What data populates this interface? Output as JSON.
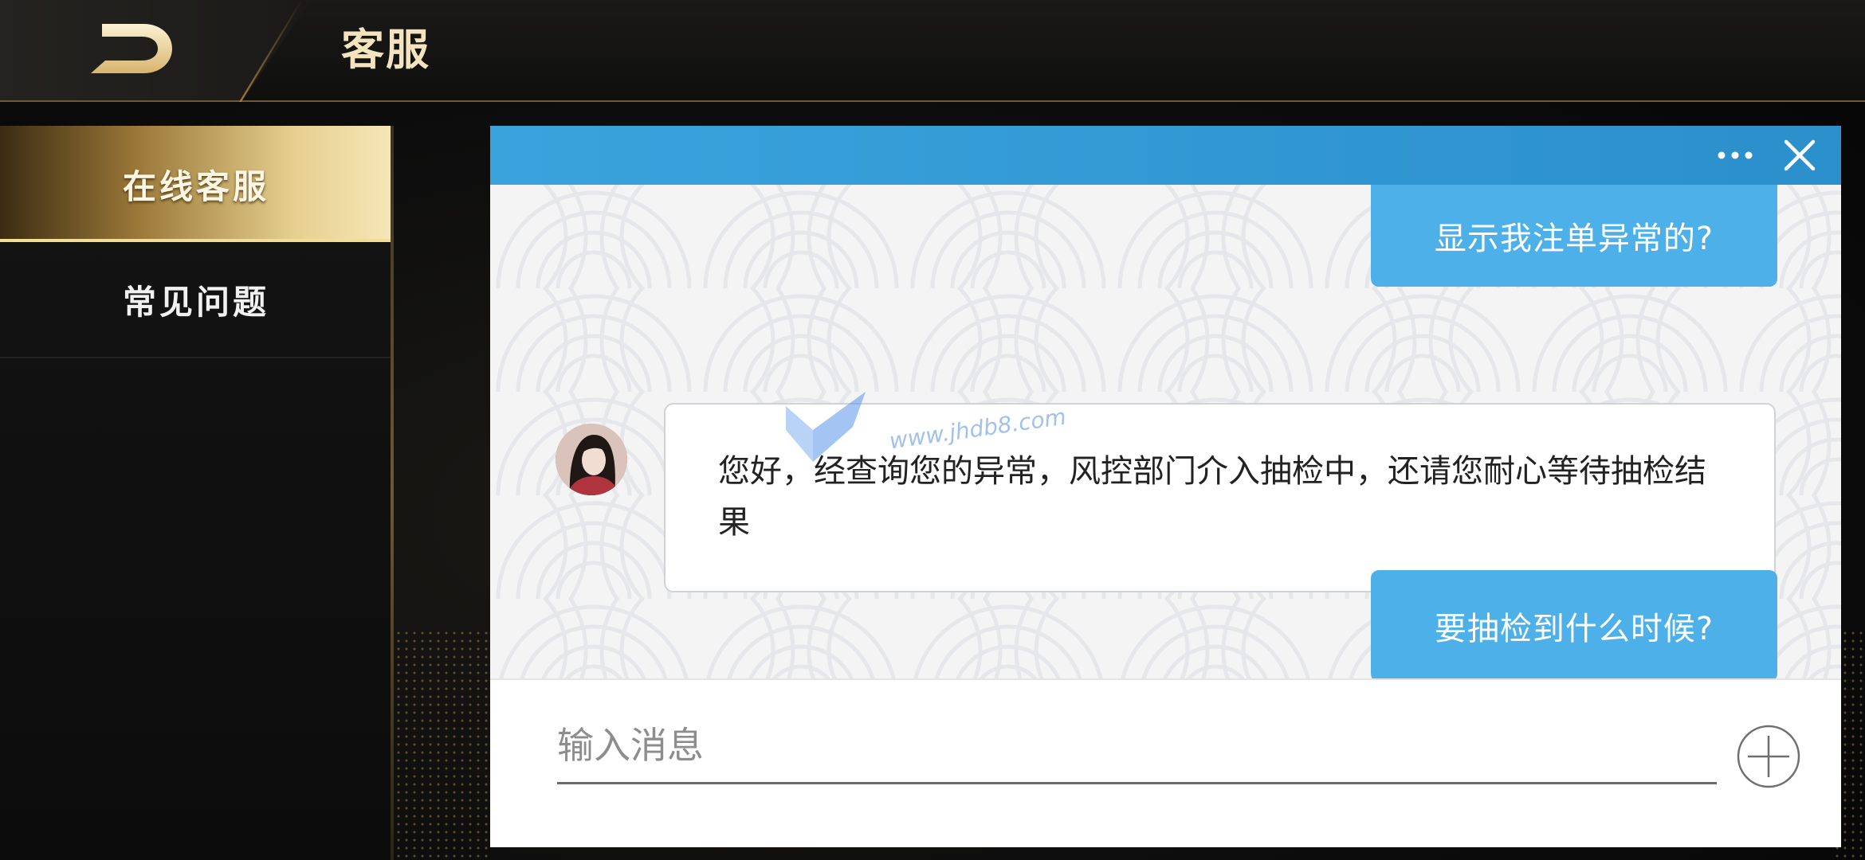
{
  "header": {
    "title": "客服",
    "back_icon": "back-arrow-icon"
  },
  "sidebar": {
    "items": [
      {
        "label": "在线客服",
        "active": true
      },
      {
        "label": "常见问题",
        "active": false
      }
    ]
  },
  "chat": {
    "header_icons": [
      "more-icon",
      "close-icon"
    ],
    "messages": [
      {
        "sender": "user",
        "text": "显示我注单异常的?"
      },
      {
        "sender": "agent",
        "text": "您好，经查询您的异常，风控部门介入抽检中，还请您耐心等待抽检结果"
      },
      {
        "sender": "user",
        "text": "要抽检到什么时候?"
      }
    ],
    "input": {
      "placeholder": "输入消息",
      "value": ""
    },
    "add_icon": "plus-circle-icon"
  },
  "watermark": {
    "text": "www.jhdb8.com"
  },
  "colors": {
    "gold_accent": "#e6cf8f",
    "chat_header": "#2b8fcb",
    "user_bubble": "#4db0e8",
    "title_text": "#f3e3bf"
  }
}
